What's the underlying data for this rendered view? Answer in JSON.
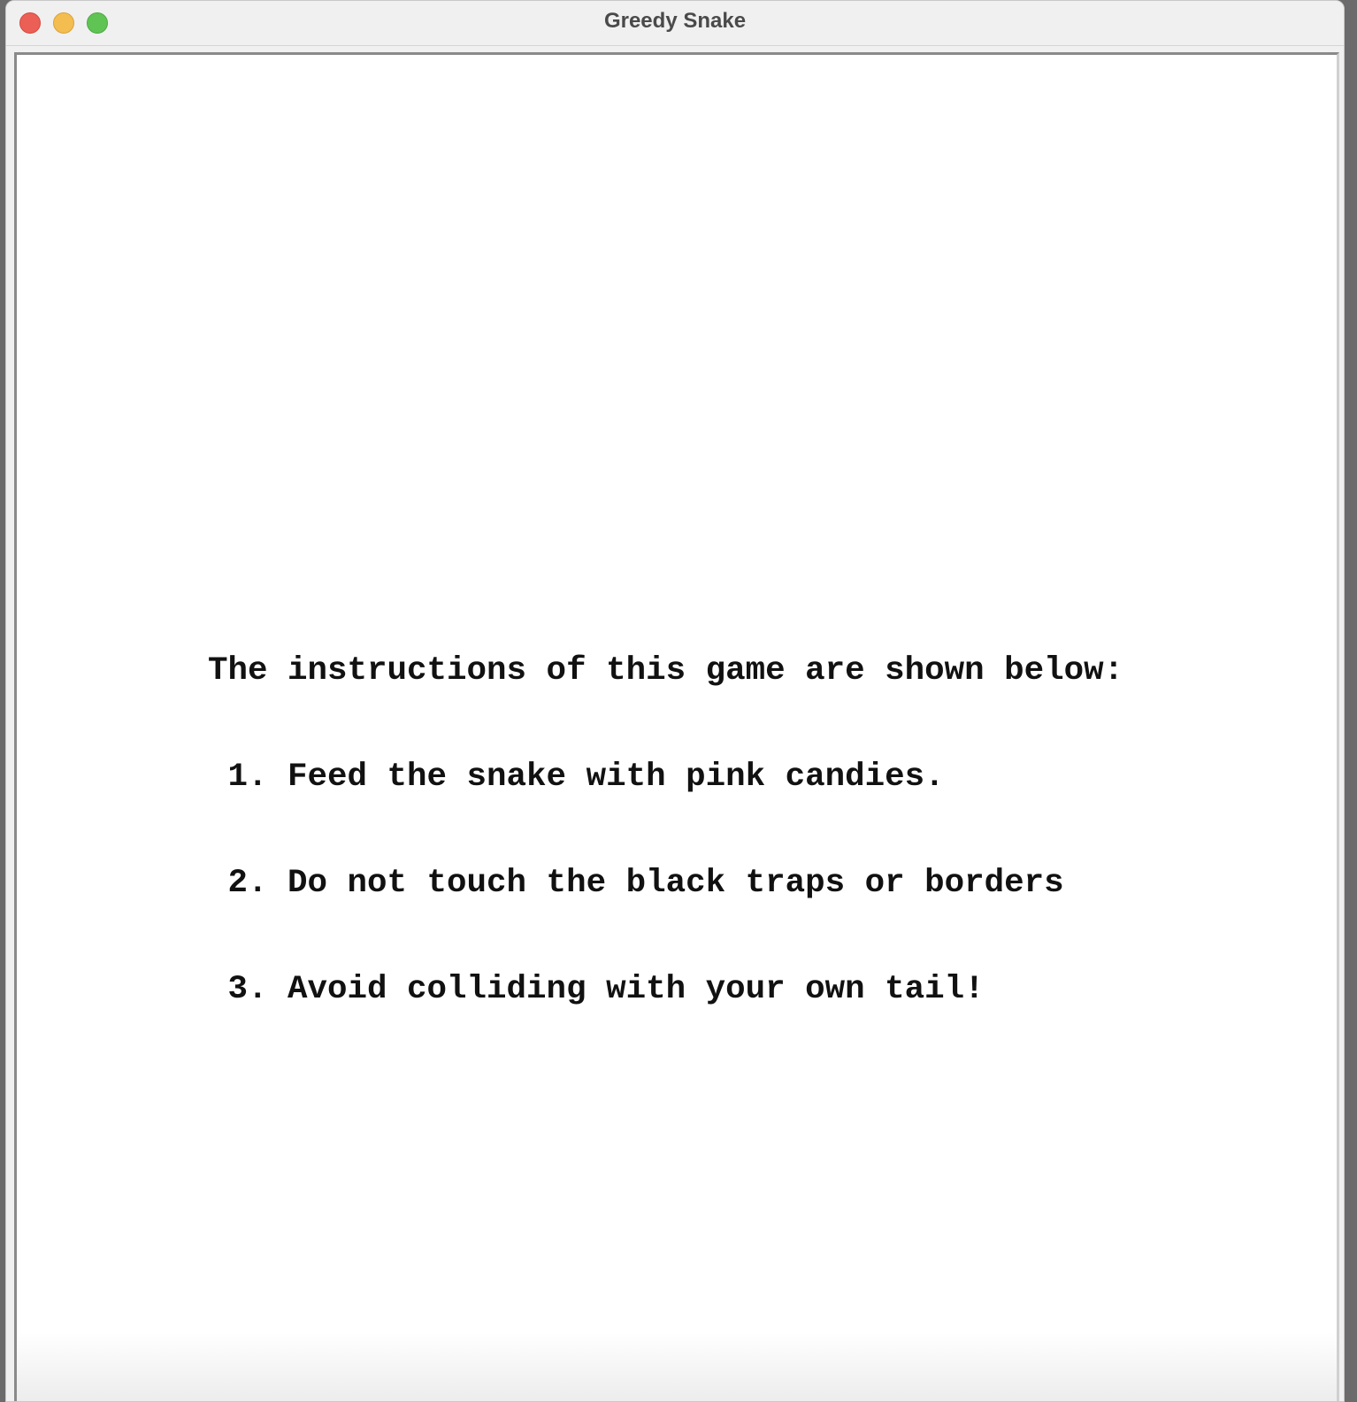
{
  "window": {
    "title": "Greedy Snake"
  },
  "game": {
    "heading": "The instructions of this game are shown below:",
    "rules": [
      " 1. Feed the snake with pink candies.",
      " 2. Do not touch the black traps or borders",
      " 3. Avoid colliding with your own tail!"
    ]
  }
}
